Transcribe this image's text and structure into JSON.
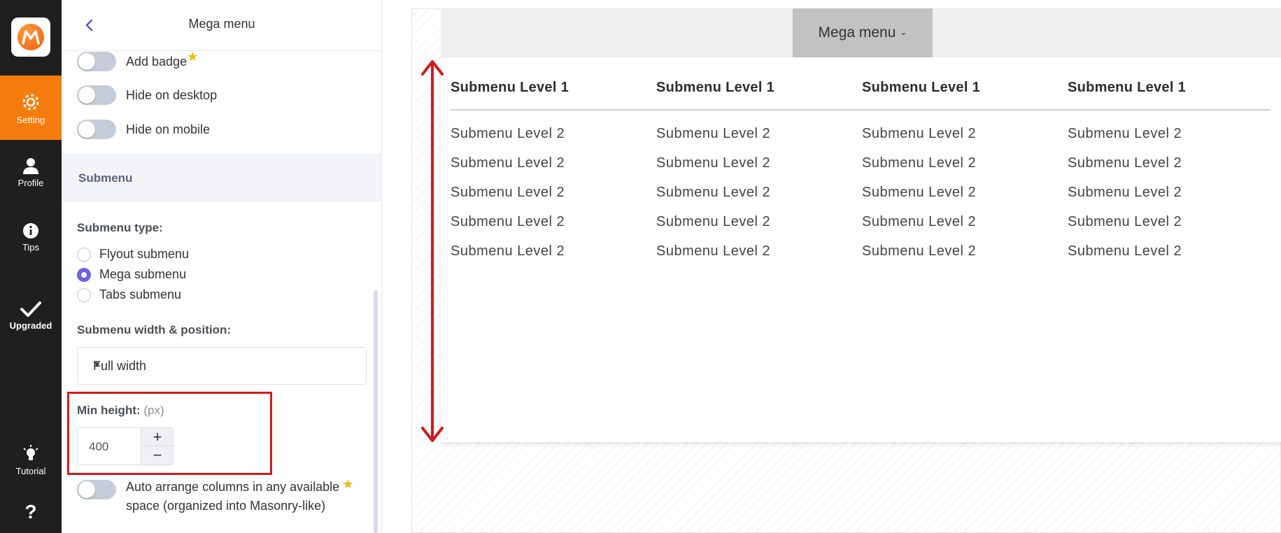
{
  "rail": {
    "logo_icon": "m-logo-icon",
    "items": [
      {
        "label": "Setting",
        "icon": "gear-icon",
        "active": true
      },
      {
        "label": "Profile",
        "icon": "user-icon"
      },
      {
        "label": "Tips",
        "icon": "info-icon"
      },
      {
        "label": "Upgraded",
        "icon": "check-icon"
      },
      {
        "label": "Tutorial",
        "icon": "lightbulb-icon"
      },
      {
        "label": "?",
        "icon": "help-icon"
      }
    ],
    "accent": "#f57c0c"
  },
  "panel": {
    "title": "Mega menu",
    "toggles": [
      {
        "label": "Add badge",
        "starred": true
      },
      {
        "label": "Hide on desktop"
      },
      {
        "label": "Hide on mobile"
      }
    ],
    "section_title": "Submenu",
    "submenu_type_label": "Submenu type:",
    "submenu_types": [
      {
        "label": "Flyout submenu",
        "selected": false
      },
      {
        "label": "Mega submenu",
        "selected": true
      },
      {
        "label": "Tabs submenu",
        "selected": false
      }
    ],
    "width_label": "Submenu width & position:",
    "width_value": "Full width",
    "min_height_label": "Min height:",
    "min_height_unit": "(px)",
    "min_height_value": "400",
    "plus": "+",
    "minus": "−",
    "auto_arrange_line1": "Auto arrange columns in any available",
    "auto_arrange_line2": "space (organized into Masonry-like)"
  },
  "preview": {
    "menu_label": "Mega menu",
    "columns": [
      {
        "heading": "Submenu Level 1",
        "items": [
          "Submenu Level 2",
          "Submenu Level 2",
          "Submenu Level 2",
          "Submenu Level 2",
          "Submenu Level 2"
        ]
      },
      {
        "heading": "Submenu Level 1",
        "items": [
          "Submenu Level 2",
          "Submenu Level 2",
          "Submenu Level 2",
          "Submenu Level 2",
          "Submenu Level 2"
        ]
      },
      {
        "heading": "Submenu Level 1",
        "items": [
          "Submenu Level 2",
          "Submenu Level 2",
          "Submenu Level 2",
          "Submenu Level 2",
          "Submenu Level 2"
        ]
      },
      {
        "heading": "Submenu Level 1",
        "items": [
          "Submenu Level 2",
          "Submenu Level 2",
          "Submenu Level 2",
          "Submenu Level 2",
          "Submenu Level 2"
        ]
      }
    ]
  }
}
